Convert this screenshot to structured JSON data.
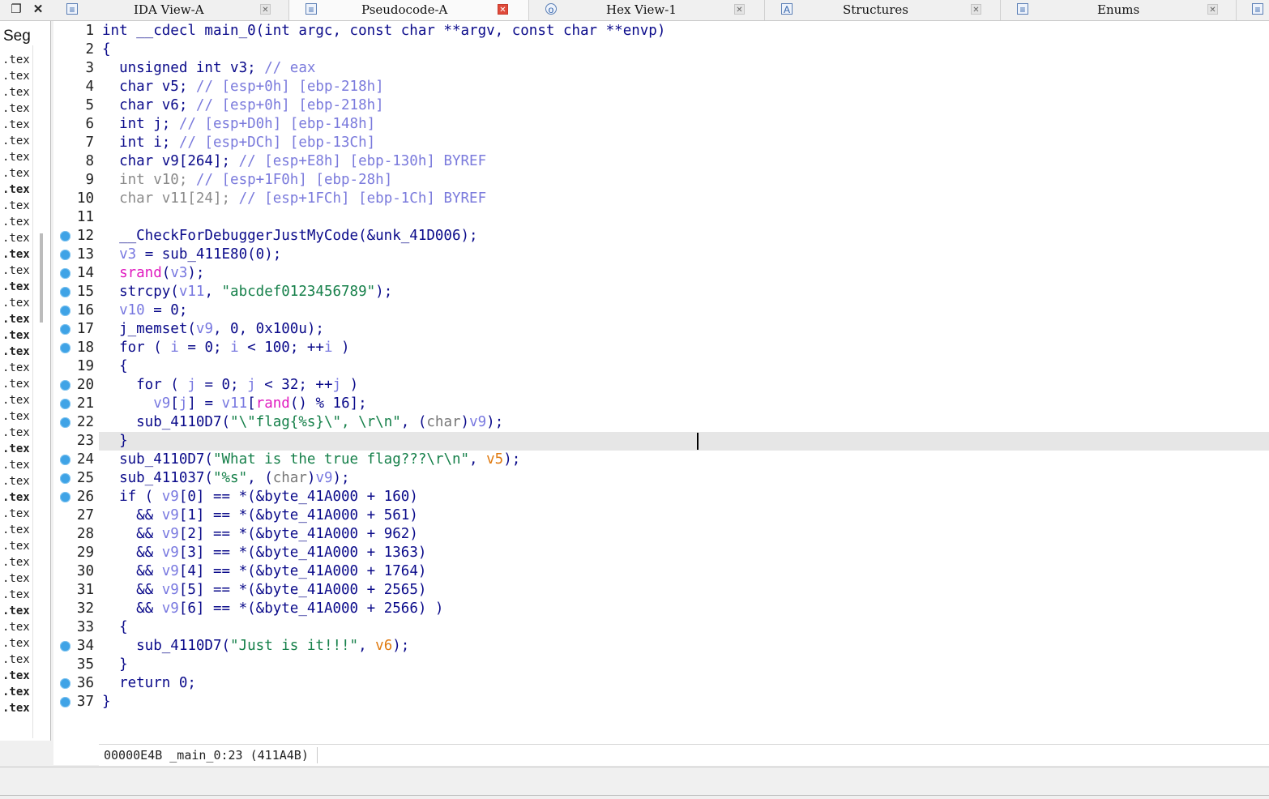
{
  "tabs": [
    {
      "label": "IDA View-A",
      "icon": "ida-view-icon"
    },
    {
      "label": "Pseudocode-A",
      "icon": "pseudocode-icon",
      "active": true
    },
    {
      "label": "Hex View-1",
      "icon": "hex-view-icon"
    },
    {
      "label": "Structures",
      "icon": "structures-icon"
    },
    {
      "label": "Enums",
      "icon": "enums-icon"
    }
  ],
  "segments": {
    "header": "Seg",
    "rows": [
      ".tex",
      ".tex",
      ".tex",
      ".tex",
      ".tex",
      ".tex",
      ".tex",
      ".tex",
      ".tex",
      ".tex",
      ".tex",
      ".tex",
      ".tex",
      ".tex",
      ".tex",
      ".tex",
      ".tex",
      ".tex",
      ".tex",
      ".tex",
      ".tex",
      ".tex",
      ".tex",
      ".tex",
      ".tex",
      ".tex",
      ".tex",
      ".tex",
      ".tex",
      ".tex",
      ".tex",
      ".tex",
      ".tex",
      ".tex",
      ".tex",
      ".tex",
      ".tex",
      ".tex",
      ".tex",
      ".tex",
      ".tex"
    ]
  },
  "code": {
    "line_numbers": [
      "1",
      "2",
      "3",
      "4",
      "5",
      "6",
      "7",
      "8",
      "9",
      "10",
      "11",
      "12",
      "13",
      "14",
      "15",
      "16",
      "17",
      "18",
      "19",
      "20",
      "21",
      "22",
      "23",
      "24",
      "25",
      "26",
      "27",
      "28",
      "29",
      "30",
      "31",
      "32",
      "33",
      "34",
      "35",
      "36",
      "37"
    ],
    "breakpoint_lines": [
      12,
      13,
      14,
      15,
      16,
      17,
      18,
      20,
      21,
      22,
      24,
      25,
      26,
      34,
      36,
      37
    ],
    "highlighted_line": 23,
    "lines": [
      [
        [
          "int __cdecl main_0(int argc, const char **argv, const char **envp)",
          "k"
        ]
      ],
      [
        [
          "{",
          "k"
        ]
      ],
      [
        [
          "  unsigned int v3; ",
          "k"
        ],
        [
          "// eax",
          "c"
        ]
      ],
      [
        [
          "  char v5; ",
          "k"
        ],
        [
          "// [esp+0h] [ebp-218h]",
          "c"
        ]
      ],
      [
        [
          "  char v6; ",
          "k"
        ],
        [
          "// [esp+0h] [ebp-218h]",
          "c"
        ]
      ],
      [
        [
          "  int j; ",
          "k"
        ],
        [
          "// [esp+D0h] [ebp-148h]",
          "c"
        ]
      ],
      [
        [
          "  int i; ",
          "k"
        ],
        [
          "// [esp+DCh] [ebp-13Ch]",
          "c"
        ]
      ],
      [
        [
          "  char v9[264]; ",
          "k"
        ],
        [
          "// [esp+E8h] [ebp-130h] BYREF",
          "c"
        ]
      ],
      [
        [
          "  int v10; ",
          "gv"
        ],
        [
          "// [esp+1F0h] [ebp-28h]",
          "c"
        ]
      ],
      [
        [
          "  char v11[24]; ",
          "gv"
        ],
        [
          "// [esp+1FCh] [ebp-1Ch] BYREF",
          "c"
        ]
      ],
      [
        [
          "",
          "k"
        ]
      ],
      [
        [
          "  __CheckForDebuggerJustMyCode(&unk_41D006);",
          "k"
        ]
      ],
      [
        [
          "  ",
          "k"
        ],
        [
          "v3",
          "v"
        ],
        [
          " = sub_411E80(0);",
          "k"
        ]
      ],
      [
        [
          "  ",
          "k"
        ],
        [
          "srand",
          "m"
        ],
        [
          "(",
          "k"
        ],
        [
          "v3",
          "v"
        ],
        [
          ");",
          "k"
        ]
      ],
      [
        [
          "  strcpy(",
          "k"
        ],
        [
          "v11",
          "v"
        ],
        [
          ", ",
          "k"
        ],
        [
          "\"abcdef0123456789\"",
          "s"
        ],
        [
          ");",
          "k"
        ]
      ],
      [
        [
          "  ",
          "k"
        ],
        [
          "v10",
          "v"
        ],
        [
          " = 0;",
          "k"
        ]
      ],
      [
        [
          "  j_memset(",
          "k"
        ],
        [
          "v9",
          "v"
        ],
        [
          ", 0, 0x100u);",
          "k"
        ]
      ],
      [
        [
          "  for ( ",
          "k"
        ],
        [
          "i",
          "v"
        ],
        [
          " = 0; ",
          "k"
        ],
        [
          "i",
          "v"
        ],
        [
          " < 100; ++",
          "k"
        ],
        [
          "i",
          "v"
        ],
        [
          " )",
          "k"
        ]
      ],
      [
        [
          "  {",
          "k"
        ]
      ],
      [
        [
          "    for ( ",
          "k"
        ],
        [
          "j",
          "v"
        ],
        [
          " = 0; ",
          "k"
        ],
        [
          "j",
          "v"
        ],
        [
          " < 32; ++",
          "k"
        ],
        [
          "j",
          "v"
        ],
        [
          " )",
          "k"
        ]
      ],
      [
        [
          "      ",
          "k"
        ],
        [
          "v9",
          "v"
        ],
        [
          "[",
          "k"
        ],
        [
          "j",
          "v"
        ],
        [
          "] = ",
          "k"
        ],
        [
          "v11",
          "v"
        ],
        [
          "[",
          "k"
        ],
        [
          "rand",
          "m"
        ],
        [
          "() % 16];",
          "k"
        ]
      ],
      [
        [
          "    sub_4110D7(",
          "k"
        ],
        [
          "\"\\\"flag{%s}\\\", \\r\\n\"",
          "s"
        ],
        [
          ", (",
          "k"
        ],
        [
          "char",
          "g"
        ],
        [
          ")",
          "k"
        ],
        [
          "v9",
          "v"
        ],
        [
          ");",
          "k"
        ]
      ],
      [
        [
          "  }",
          "k"
        ]
      ],
      [
        [
          "  sub_4110D7(",
          "k"
        ],
        [
          "\"What is the true flag???\\r\\n\"",
          "s"
        ],
        [
          ", ",
          "k"
        ],
        [
          "v5",
          "o"
        ],
        [
          ");",
          "k"
        ]
      ],
      [
        [
          "  sub_411037(",
          "k"
        ],
        [
          "\"%s\"",
          "s"
        ],
        [
          ", (",
          "k"
        ],
        [
          "char",
          "g"
        ],
        [
          ")",
          "k"
        ],
        [
          "v9",
          "v"
        ],
        [
          ");",
          "k"
        ]
      ],
      [
        [
          "  if ( ",
          "k"
        ],
        [
          "v9",
          "v"
        ],
        [
          "[0] == *(&byte_41A000 + 160)",
          "k"
        ]
      ],
      [
        [
          "    && ",
          "k"
        ],
        [
          "v9",
          "v"
        ],
        [
          "[1] == *(&byte_41A000 + 561)",
          "k"
        ]
      ],
      [
        [
          "    && ",
          "k"
        ],
        [
          "v9",
          "v"
        ],
        [
          "[2] == *(&byte_41A000 + 962)",
          "k"
        ]
      ],
      [
        [
          "    && ",
          "k"
        ],
        [
          "v9",
          "v"
        ],
        [
          "[3] == *(&byte_41A000 + 1363)",
          "k"
        ]
      ],
      [
        [
          "    && ",
          "k"
        ],
        [
          "v9",
          "v"
        ],
        [
          "[4] == *(&byte_41A000 + 1764)",
          "k"
        ]
      ],
      [
        [
          "    && ",
          "k"
        ],
        [
          "v9",
          "v"
        ],
        [
          "[5] == *(&byte_41A000 + 2565)",
          "k"
        ]
      ],
      [
        [
          "    && ",
          "k"
        ],
        [
          "v9",
          "v"
        ],
        [
          "[6] == *(&byte_41A000 + 2566) )",
          "k"
        ]
      ],
      [
        [
          "  {",
          "k"
        ]
      ],
      [
        [
          "    sub_4110D7(",
          "k"
        ],
        [
          "\"Just is it!!!\"",
          "s"
        ],
        [
          ", ",
          "k"
        ],
        [
          "v6",
          "o"
        ],
        [
          ");",
          "k"
        ]
      ],
      [
        [
          "  }",
          "k"
        ]
      ],
      [
        [
          "  return 0;",
          "k"
        ]
      ],
      [
        [
          "}",
          "k"
        ]
      ]
    ]
  },
  "status": {
    "text": "00000E4B _main_0:23 (411A4B)"
  },
  "colors": {
    "keyword": "#0a0a8a",
    "comment": "#7a7adc",
    "variable": "#7878e0",
    "string": "#16804a",
    "library_func": "#e01bbf",
    "stack_var": "#e07a10",
    "breakpoint": "#3fa3e6",
    "active_tab_close": "#e04a3a"
  }
}
